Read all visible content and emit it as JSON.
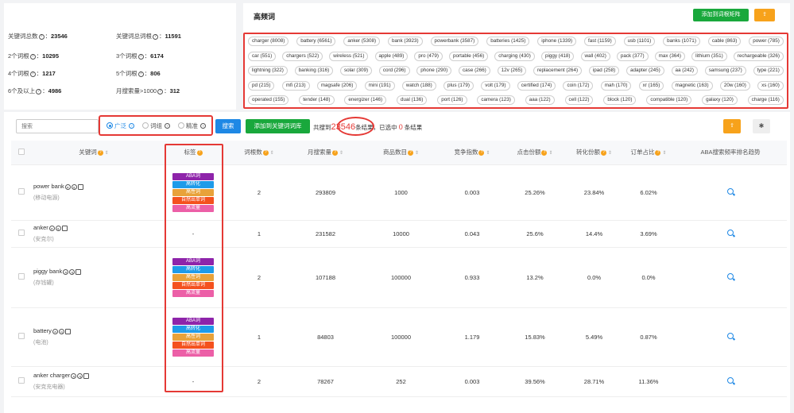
{
  "stats": [
    {
      "label": "关键词总数",
      "value": "23546"
    },
    {
      "label": "关键词总词根",
      "value": "11591"
    },
    {
      "label": "2个词根",
      "value": "10295"
    },
    {
      "label": "3个词根",
      "value": "6174"
    },
    {
      "label": "4个词根",
      "value": "1217"
    },
    {
      "label": "5个词根",
      "value": "806"
    },
    {
      "label": "6个及以上",
      "value": "4986"
    },
    {
      "label": "月搜索量>1000",
      "value": "312"
    }
  ],
  "high_freq": {
    "title": "高频词",
    "add_button": "添加到词根矩阵",
    "upload_icon": "upload-icon",
    "rows": [
      [
        "charger (8008)",
        "battery (6561)",
        "anker (5308)",
        "bank (3923)",
        "powerbank (3587)",
        "batteries (1425)",
        "iphone (1339)",
        "fast (1159)",
        "usb (1101)",
        "banks (1071)",
        "cable (863)",
        "power (785)"
      ],
      [
        "car (551)",
        "chargers (522)",
        "wireless (521)",
        "apple (489)",
        "pro (479)",
        "portable (456)",
        "charging (430)",
        "piggy (418)",
        "wall (402)",
        "pack (377)",
        "max (364)",
        "lithium (351)",
        "rechargeable (326)"
      ],
      [
        "lightning (322)",
        "banking (316)",
        "solar (309)",
        "cord (296)",
        "phone (290)",
        "case (266)",
        "12v (265)",
        "replacement (264)",
        "ipad (258)",
        "adapter (245)",
        "aa (242)",
        "samsung (237)",
        "type (221)"
      ],
      [
        "pd (215)",
        "mfi (213)",
        "magsafe (206)",
        "mini (191)",
        "watch (188)",
        "plus (179)",
        "volt (179)",
        "certified (174)",
        "coin (172)",
        "mah (170)",
        "xr (165)",
        "magnetic (163)",
        "20w (160)",
        "xs (160)"
      ],
      [
        "operated (155)",
        "tender (148)",
        "energizer (146)",
        "dual (136)",
        "port (126)",
        "camera (123)",
        "aaa (122)",
        "cell (122)",
        "block (120)",
        "compatible (120)",
        "galaxy (120)",
        "charge (116)"
      ]
    ]
  },
  "toolbar": {
    "search_placeholder": "搜索",
    "radio_options": [
      "广泛",
      "词组",
      "精准"
    ],
    "selected_radio": "广泛",
    "search_button": "搜索",
    "add_button": "添加到关键词词库",
    "summary_prefix": "共搜到",
    "total": "23546",
    "summary_mid": "条结果，已选中",
    "selected": "0",
    "summary_suffix": "条结果"
  },
  "table": {
    "headers": [
      "关键词",
      "标签",
      "词根数",
      "月搜索量",
      "商品数目",
      "竞争指数",
      "点击份额",
      "转化份额",
      "订单占比",
      "ABA搜索频率排名趋势"
    ],
    "tag_colors": {
      "ABA词": "#8e24aa",
      "高转化": "#1e9be9",
      "高性词": "#e8a23a",
      "自然出单词": "#f4511e",
      "高流量": "#ec5fa7"
    },
    "rows": [
      {
        "keyword": "power bank",
        "translation": "(移动电源)",
        "tags": [
          "ABA词",
          "高转化",
          "高性词",
          "自然出单词",
          "高流量"
        ],
        "roots": "2",
        "monthly": "293809",
        "products": "1000",
        "competition": "0.003",
        "click": "25.26%",
        "conversion": "23.84%",
        "order": "6.02%"
      },
      {
        "keyword": "anker",
        "translation": "(安克尔)",
        "tags": [],
        "roots": "1",
        "monthly": "231582",
        "products": "10000",
        "competition": "0.043",
        "click": "25.6%",
        "conversion": "14.4%",
        "order": "3.69%"
      },
      {
        "keyword": "piggy bank",
        "translation": "(存钱罐)",
        "tags": [
          "ABA词",
          "高转化",
          "高性词",
          "自然出单词",
          "高流量"
        ],
        "roots": "2",
        "monthly": "107188",
        "products": "100000",
        "competition": "0.933",
        "click": "13.2%",
        "conversion": "0.0%",
        "order": "0.0%"
      },
      {
        "keyword": "battery",
        "translation": "(电池)",
        "tags": [
          "ABA词",
          "高转化",
          "高性词",
          "自然出单词",
          "高流量"
        ],
        "roots": "1",
        "monthly": "84803",
        "products": "100000",
        "competition": "1.179",
        "click": "15.83%",
        "conversion": "5.49%",
        "order": "0.87%"
      },
      {
        "keyword": "anker charger",
        "translation": "(安克充电器)",
        "tags": [],
        "roots": "2",
        "monthly": "78267",
        "products": "252",
        "competition": "0.003",
        "click": "39.56%",
        "conversion": "28.71%",
        "order": "11.36%"
      }
    ],
    "empty_tag": "-"
  }
}
